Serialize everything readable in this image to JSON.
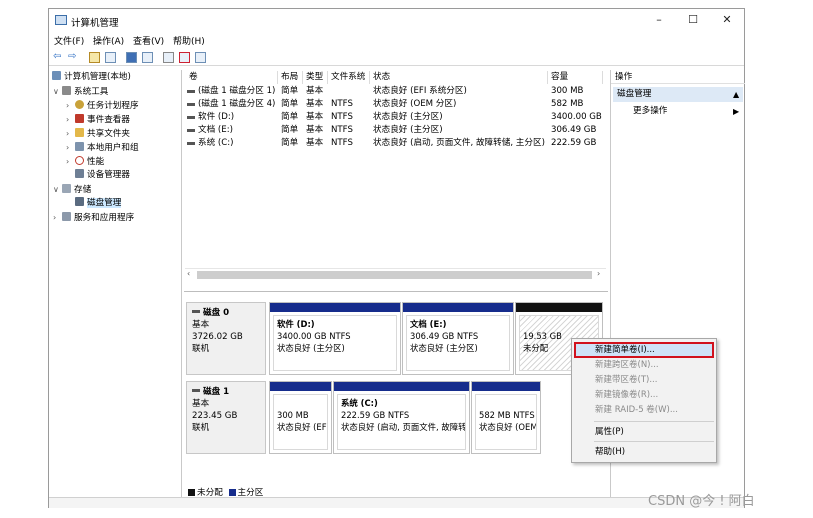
{
  "window": {
    "title": "计算机管理",
    "minimize": "–",
    "maximize": "☐",
    "close": "✕"
  },
  "menu": [
    "文件(F)",
    "操作(A)",
    "查看(V)",
    "帮助(H)"
  ],
  "toolbar": {
    "back": "⇦",
    "forward": "⇨"
  },
  "tree": [
    {
      "label": "计算机管理(本地)",
      "toggle": ""
    },
    {
      "label": "系统工具",
      "toggle": "∨"
    },
    {
      "label": "任务计划程序",
      "toggle": "›"
    },
    {
      "label": "事件查看器",
      "toggle": "›"
    },
    {
      "label": "共享文件夹",
      "toggle": "›"
    },
    {
      "label": "本地用户和组",
      "toggle": "›"
    },
    {
      "label": "性能",
      "toggle": "›"
    },
    {
      "label": "设备管理器",
      "toggle": ""
    },
    {
      "label": "存储",
      "toggle": "∨"
    },
    {
      "label": "磁盘管理",
      "toggle": ""
    },
    {
      "label": "服务和应用程序",
      "toggle": "›"
    }
  ],
  "volume_list": {
    "columns": [
      "卷",
      "布局",
      "类型",
      "文件系统",
      "状态",
      "容量"
    ],
    "rows": [
      [
        "(磁盘 1 磁盘分区 1)",
        "简单",
        "基本",
        "",
        "状态良好 (EFI 系统分区)",
        "300 MB"
      ],
      [
        "(磁盘 1 磁盘分区 4)",
        "简单",
        "基本",
        "NTFS",
        "状态良好 (OEM 分区)",
        "582 MB"
      ],
      [
        "软件 (D:)",
        "简单",
        "基本",
        "NTFS",
        "状态良好 (主分区)",
        "3400.00 GB"
      ],
      [
        "文档 (E:)",
        "简单",
        "基本",
        "NTFS",
        "状态良好 (主分区)",
        "306.49 GB"
      ],
      [
        "系统 (C:)",
        "简单",
        "基本",
        "NTFS",
        "状态良好 (启动, 页面文件, 故障转储, 主分区)",
        "222.59 GB"
      ]
    ]
  },
  "scroll": {
    "left": "‹",
    "right": "›"
  },
  "disks": {
    "disk0": {
      "name": "磁盘 0",
      "type": "基本",
      "size": "3726.02 GB",
      "state": "联机",
      "partitions": [
        {
          "title": "软件 (D:)",
          "line1": "3400.00 GB NTFS",
          "line2": "状态良好 (主分区)"
        },
        {
          "title": "文档 (E:)",
          "line1": "306.49 GB NTFS",
          "line2": "状态良好 (主分区)"
        },
        {
          "title": "",
          "line1": "19.53 GB",
          "line2": "未分配"
        }
      ]
    },
    "disk1": {
      "name": "磁盘 1",
      "type": "基本",
      "size": "223.45 GB",
      "state": "联机",
      "partitions": [
        {
          "title": "",
          "line1": "300 MB",
          "line2": "状态良好 (EFI"
        },
        {
          "title": "系统 (C:)",
          "line1": "222.59 GB NTFS",
          "line2": "状态良好 (启动, 页面文件, 故障转储"
        },
        {
          "title": "",
          "line1": "582 MB NTFS",
          "line2": "状态良好 (OEM"
        }
      ]
    }
  },
  "legend": {
    "unallocated": "未分配",
    "primary": "主分区"
  },
  "actions": {
    "header": "操作",
    "section": "磁盘管理",
    "more": "更多操作",
    "arrow_up": "▲",
    "arrow_right": "▶"
  },
  "context_menu": {
    "items": [
      {
        "label": "新建简单卷(I)...",
        "enabled": true
      },
      {
        "label": "新建跨区卷(N)...",
        "enabled": false
      },
      {
        "label": "新建带区卷(T)...",
        "enabled": false
      },
      {
        "label": "新建镜像卷(R)...",
        "enabled": false
      },
      {
        "label": "新建 RAID-5 卷(W)...",
        "enabled": false
      },
      {
        "label": "属性(P)",
        "enabled": true
      },
      {
        "label": "帮助(H)",
        "enabled": true
      }
    ]
  },
  "watermark": "CSDN @今 ! 阿白",
  "colors": {
    "primary_partition": "#162c8c",
    "unallocated": "#111111",
    "highlight_border": "#d1121d"
  }
}
